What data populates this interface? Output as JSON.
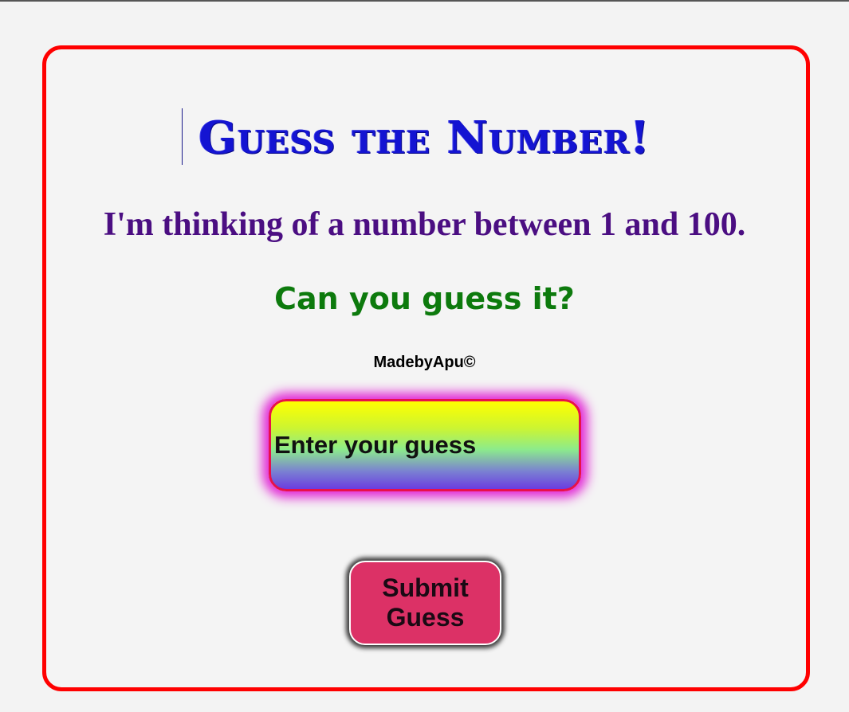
{
  "game": {
    "title": "Guess the Number!",
    "instructions": "I'm thinking of a number between 1 and 100.",
    "question": "Can you guess it?",
    "credit": "MadebyApu©"
  },
  "guess_input": {
    "placeholder": "Enter your guess",
    "value": ""
  },
  "submit_button": {
    "label": "Submit Guess"
  },
  "colors": {
    "card_border": "#ff0000",
    "title": "#1414d2",
    "instructions": "#4b0e82",
    "question": "#0d7a0d",
    "input_border": "#e8104a",
    "input_glow": "#e22ad6",
    "submit_background": "#dc3166"
  }
}
